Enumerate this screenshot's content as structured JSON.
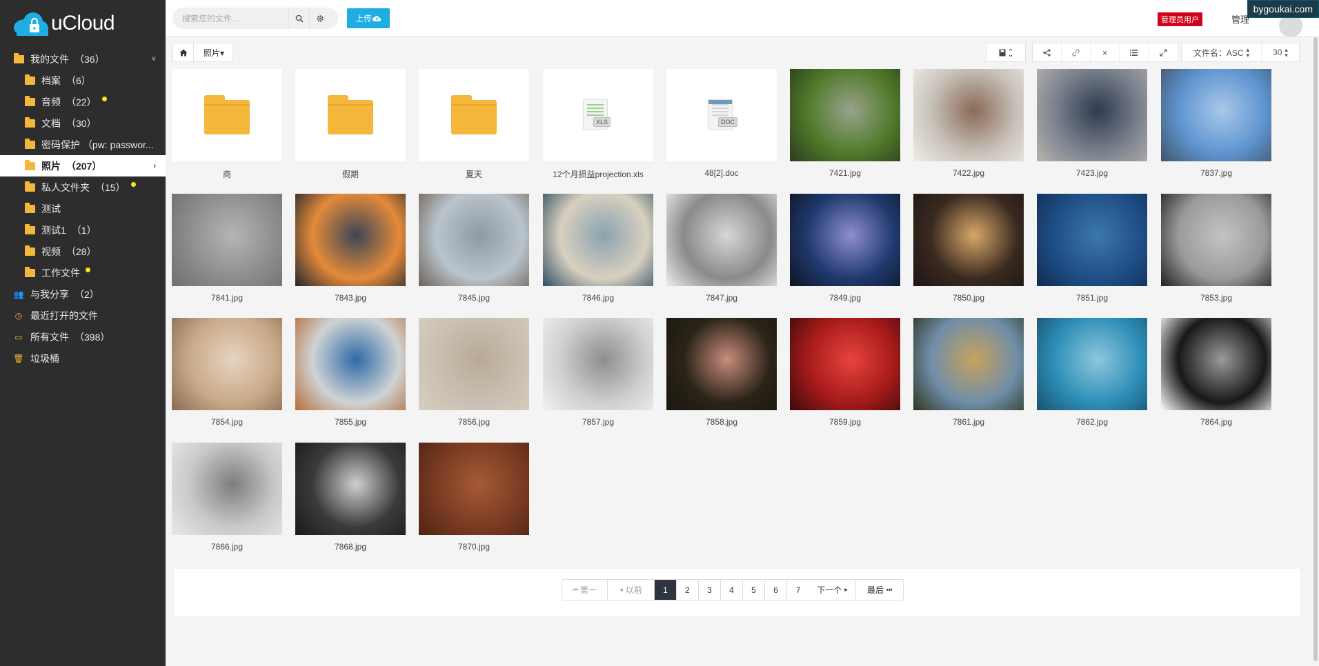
{
  "brand": {
    "name": "uCloud"
  },
  "watermark": "bygoukai.com",
  "sidebar": {
    "items": [
      {
        "label": "我的文件",
        "count": "（36）",
        "icon": "folder-icon",
        "caret": "˅"
      },
      {
        "label": "档案",
        "count": "（6）",
        "icon": "folder-icon"
      },
      {
        "label": "音频",
        "count": "（22）",
        "icon": "folder-icon",
        "locked": true
      },
      {
        "label": "文档",
        "count": "（30）",
        "icon": "folder-icon"
      },
      {
        "label": "密码保护 （pw: passwor...",
        "count": "",
        "icon": "folder-icon"
      },
      {
        "label": "照片",
        "count": "（207）",
        "icon": "folder-icon",
        "active": true,
        "caret": "›"
      },
      {
        "label": "私人文件夹",
        "count": "（15）",
        "icon": "folder-icon",
        "locked": true
      },
      {
        "label": "测试",
        "count": "",
        "icon": "folder-icon"
      },
      {
        "label": "测试1",
        "count": "（1）",
        "icon": "folder-icon"
      },
      {
        "label": "视频",
        "count": "（28）",
        "icon": "folder-icon"
      },
      {
        "label": "工作文件",
        "count": "",
        "icon": "folder-icon",
        "locked": true
      },
      {
        "label": "与我分享",
        "count": "（2）",
        "icon": "users-icon"
      },
      {
        "label": "最近打开的文件",
        "count": "",
        "icon": "clock-icon"
      },
      {
        "label": "所有文件",
        "count": "（398）",
        "icon": "drive-icon"
      },
      {
        "label": "垃圾桶",
        "count": "",
        "icon": "trash-icon"
      }
    ]
  },
  "topbar": {
    "search_placeholder": "搜索您的文件...",
    "upload_label": "上传",
    "admin_badge": "管理员用户",
    "manage_label": "管理"
  },
  "breadcrumb": {
    "current": "照片▾"
  },
  "toolbar": {
    "sort_label": "文件名：ASC",
    "per_page": "30"
  },
  "files": [
    {
      "name": "商",
      "kind": "folder"
    },
    {
      "name": "假期",
      "kind": "folder"
    },
    {
      "name": "夏天",
      "kind": "folder"
    },
    {
      "name": "12个月损益projection.xls",
      "kind": "xls",
      "tag": "XLS"
    },
    {
      "name": "48[2].doc",
      "kind": "doc",
      "tag": "DOC"
    },
    {
      "name": "7421.jpg",
      "kind": "image",
      "colors": [
        "#4e7a2a",
        "#9aa38c",
        "#2d3a1c"
      ]
    },
    {
      "name": "7422.jpg",
      "kind": "image",
      "colors": [
        "#c8c2ba",
        "#8a6a55",
        "#efece7"
      ]
    },
    {
      "name": "7423.jpg",
      "kind": "image",
      "colors": [
        "#7c8390",
        "#2f3a4e",
        "#b9b3ad"
      ]
    },
    {
      "name": "7837.jpg",
      "kind": "image",
      "colors": [
        "#5e94d0",
        "#a9c8ea",
        "#3f5566"
      ]
    },
    {
      "name": "7841.jpg",
      "kind": "image",
      "colors": [
        "#8d8d8d",
        "#b5b5b5",
        "#6e6e6e"
      ]
    },
    {
      "name": "7843.jpg",
      "kind": "image",
      "colors": [
        "#e48a3a",
        "#3b4656",
        "#1f262d"
      ]
    },
    {
      "name": "7845.jpg",
      "kind": "image",
      "colors": [
        "#b9c4cd",
        "#8e9aa3",
        "#6f6255"
      ]
    },
    {
      "name": "7846.jpg",
      "kind": "image",
      "colors": [
        "#d8d0bf",
        "#8aa3b0",
        "#2f4e63"
      ]
    },
    {
      "name": "7847.jpg",
      "kind": "image",
      "colors": [
        "#8a8a8a",
        "#d7d7d7",
        "#eeeeee"
      ]
    },
    {
      "name": "7849.jpg",
      "kind": "image",
      "colors": [
        "#1f3a6e",
        "#8e8ecb",
        "#0e1322"
      ]
    },
    {
      "name": "7850.jpg",
      "kind": "image",
      "colors": [
        "#3a2a20",
        "#d8a86a",
        "#1b1512"
      ]
    },
    {
      "name": "7851.jpg",
      "kind": "image",
      "colors": [
        "#1f4f86",
        "#3c77ad",
        "#0f2c52"
      ]
    },
    {
      "name": "7853.jpg",
      "kind": "image",
      "colors": [
        "#9a9a9a",
        "#c4c4c4",
        "#1f1f1f"
      ]
    },
    {
      "name": "7854.jpg",
      "kind": "image",
      "colors": [
        "#c9a98a",
        "#e6d4bf",
        "#8a6b50"
      ]
    },
    {
      "name": "7855.jpg",
      "kind": "image",
      "colors": [
        "#cfd3d4",
        "#2e6aa6",
        "#b46d3a"
      ]
    },
    {
      "name": "7856.jpg",
      "kind": "image",
      "colors": [
        "#c9c0b3",
        "#b8aa95",
        "#d8cfbf"
      ]
    },
    {
      "name": "7857.jpg",
      "kind": "image",
      "colors": [
        "#cfcfcf",
        "#8e8e8e",
        "#f1f1f1"
      ]
    },
    {
      "name": "7858.jpg",
      "kind": "image",
      "colors": [
        "#2a2418",
        "#c98c7b",
        "#1a1710"
      ]
    },
    {
      "name": "7859.jpg",
      "kind": "image",
      "colors": [
        "#a51a1a",
        "#e8443c",
        "#3a0a0a"
      ]
    },
    {
      "name": "7861.jpg",
      "kind": "image",
      "colors": [
        "#6f8ea8",
        "#c7a25c",
        "#2e3520"
      ]
    },
    {
      "name": "7862.jpg",
      "kind": "image",
      "colors": [
        "#2e8fb7",
        "#8ec7de",
        "#17516e"
      ]
    },
    {
      "name": "7864.jpg",
      "kind": "image",
      "colors": [
        "#181818",
        "#9a9a9a",
        "#ffffff"
      ]
    },
    {
      "name": "7866.jpg",
      "kind": "image",
      "colors": [
        "#c9c9c9",
        "#7d7d7d",
        "#e8e8e8"
      ]
    },
    {
      "name": "7868.jpg",
      "kind": "image",
      "colors": [
        "#3a3a3a",
        "#cfcfcf",
        "#1a1a1a"
      ]
    },
    {
      "name": "7870.jpg",
      "kind": "image",
      "colors": [
        "#7a3b22",
        "#a65a35",
        "#4e2414"
      ]
    }
  ],
  "pagination": {
    "first": "第一",
    "prev": "以前",
    "pages": [
      "1",
      "2",
      "3",
      "4",
      "5",
      "6",
      "7"
    ],
    "current": "1",
    "next": "下一个",
    "last": "最后"
  },
  "colors": {
    "sidebar_bg": "#2d2d2d",
    "accent": "#1eaee3",
    "badge": "#d0021b",
    "folder": "#f5b73b"
  }
}
